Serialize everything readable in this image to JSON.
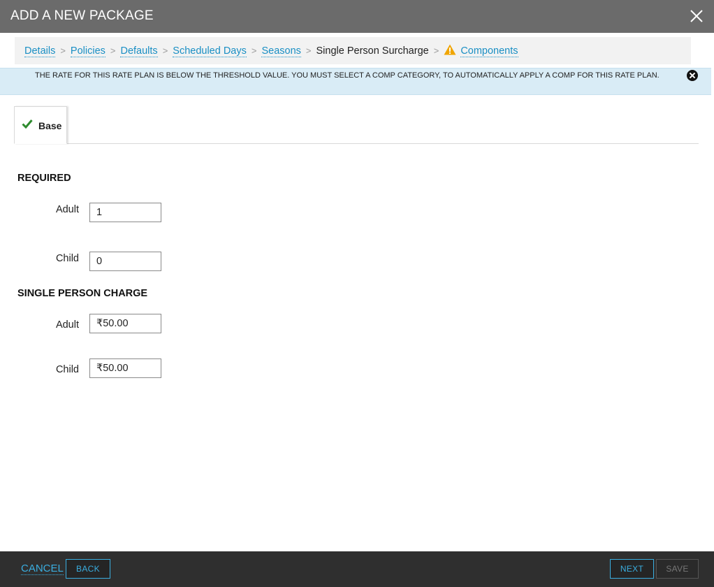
{
  "dialog": {
    "title": "ADD A NEW PACKAGE"
  },
  "breadcrumb": {
    "details": "Details",
    "policies": "Policies",
    "defaults": "Defaults",
    "scheduled_days": "Scheduled Days",
    "seasons": "Seasons",
    "single_person_surcharge": "Single Person Surcharge",
    "components": "Components",
    "separator": ">"
  },
  "alert": {
    "message": "THE RATE FOR THIS RATE PLAN IS BELOW THE THRESHOLD VALUE. YOU MUST SELECT A COMP CATEGORY, TO AUTOMATICALLY APPLY A COMP FOR THIS RATE PLAN."
  },
  "tabs": {
    "base": "Base"
  },
  "required": {
    "heading": "REQUIRED",
    "adult_label": "Adult",
    "adult_value": "1",
    "child_label": "Child",
    "child_value": "0"
  },
  "single_person_charge": {
    "heading": "SINGLE PERSON CHARGE",
    "adult_label": "Adult",
    "adult_value": "₹50.00",
    "child_label": "Child",
    "child_value": "₹50.00"
  },
  "footer": {
    "cancel": "CANCEL",
    "back": "BACK",
    "next": "NEXT",
    "save": "SAVE"
  },
  "colors": {
    "title_bar": "#6b6b6b",
    "link": "#1a8fc4",
    "alert_bg": "#d9ecf6",
    "footer_bg": "#2f2f2f",
    "accent_button": "#3aaee0",
    "check": "#2e8b2e",
    "warning": "#f0a500"
  }
}
